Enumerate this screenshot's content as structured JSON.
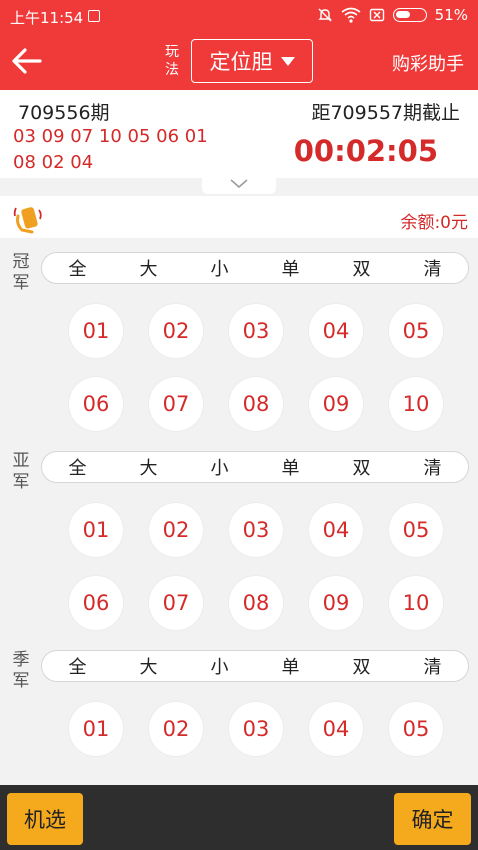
{
  "status_bar": {
    "time": "上午11:54",
    "battery": "51%"
  },
  "header": {
    "play_label": "玩法",
    "mode": "定位胆",
    "helper": "购彩助手"
  },
  "draw": {
    "current_period": "709556期",
    "last_numbers": "03 09 07 10 05 06 01 08 02 04",
    "next_label": "距709557期截止",
    "countdown": "00:02:05"
  },
  "balance": "余额:0元",
  "quick_buttons": [
    "全",
    "大",
    "小",
    "单",
    "双",
    "清"
  ],
  "positions": [
    {
      "label": "冠军",
      "numbers": [
        "01",
        "02",
        "03",
        "04",
        "05",
        "06",
        "07",
        "08",
        "09",
        "10"
      ]
    },
    {
      "label": "亚军",
      "numbers": [
        "01",
        "02",
        "03",
        "04",
        "05",
        "06",
        "07",
        "08",
        "09",
        "10"
      ]
    },
    {
      "label": "季军",
      "numbers": [
        "01",
        "02",
        "03",
        "04",
        "05"
      ]
    }
  ],
  "bottom": {
    "random_label": "机选",
    "confirm_label": "确定"
  }
}
